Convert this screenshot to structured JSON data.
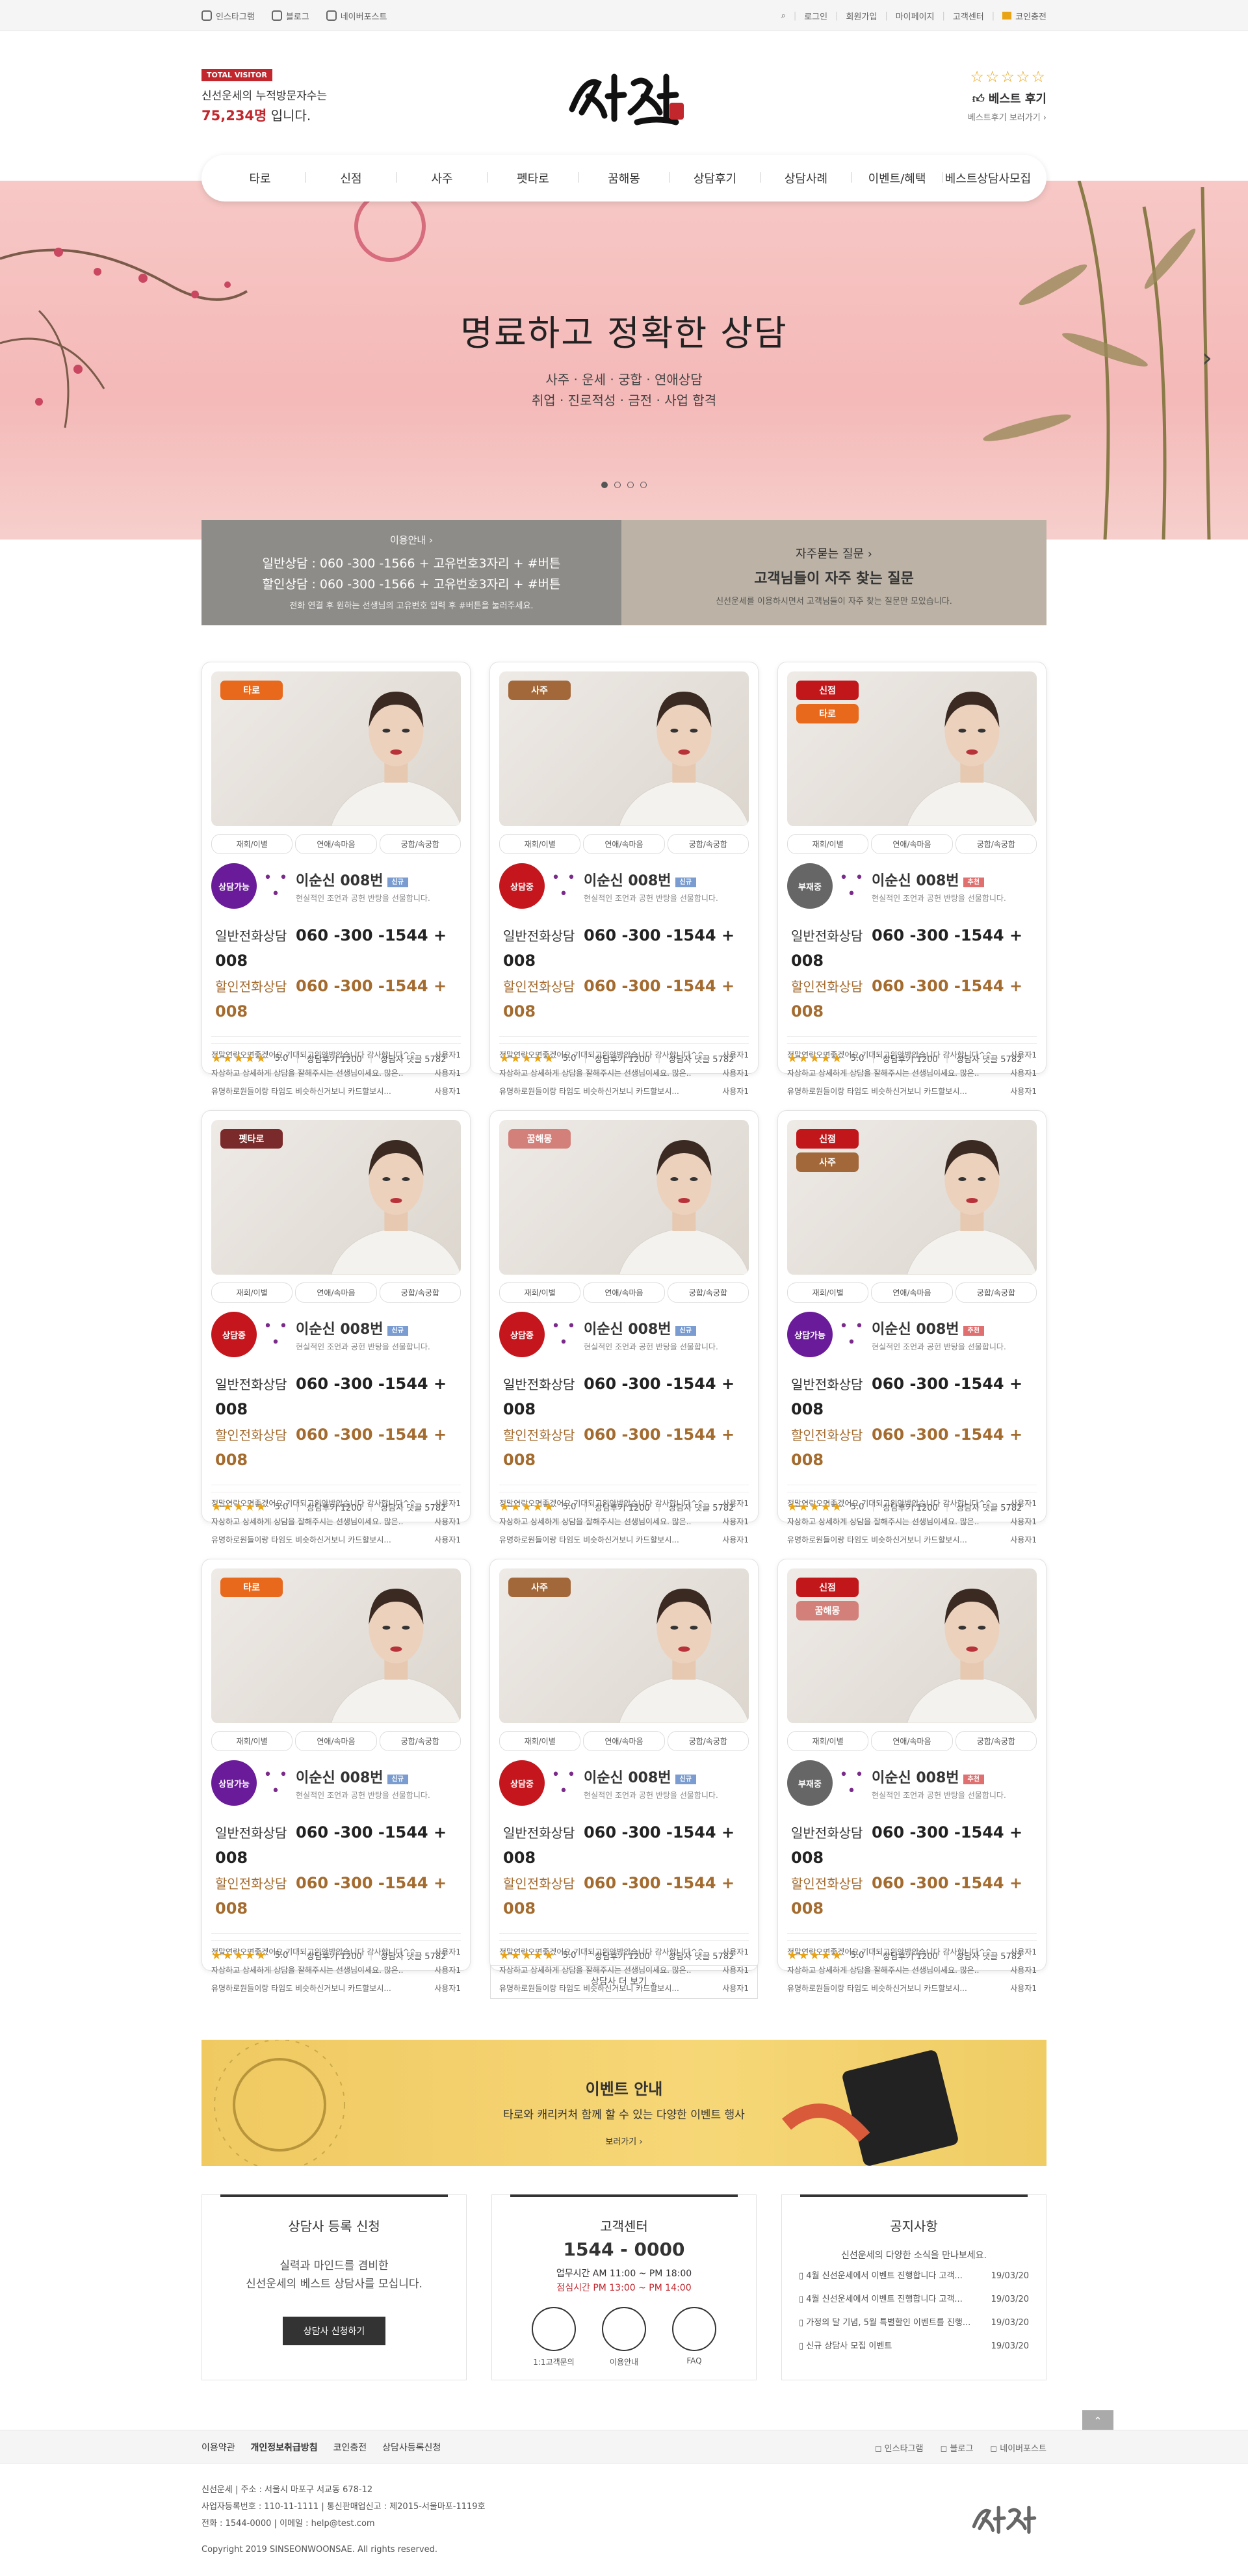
{
  "topbar": {
    "left": [
      "인스타그램",
      "블로그",
      "네이버포스트"
    ],
    "right": [
      "로그인",
      "회원가입",
      "마이페이지",
      "고객센터",
      "코인충전"
    ]
  },
  "visitor": {
    "badge": "TOTAL VISITOR",
    "line": "신선운세의 누적방문자수는",
    "num": "75,234명",
    "suffix": " 입니다."
  },
  "best": {
    "stars": "☆☆☆☆☆",
    "title": "베스트 후기",
    "sub": "베스트후기 보러가기 ›"
  },
  "nav": [
    "타로",
    "신점",
    "사주",
    "펫타로",
    "꿈해몽",
    "상담후기",
    "상담사례",
    "이벤트/혜택",
    "베스트상담사모집"
  ],
  "hero": {
    "title": "명료하고 정확한 상담",
    "sub1": "사주 · 운세 · 궁합 · 연애상담",
    "sub2": "취업 · 진로적성 · 금전 · 사업 합격"
  },
  "info": {
    "label": "이용안내 ›",
    "line1": "일반상담 : 060 -300 -1566 + 고유번호3자리 + #버튼",
    "line2": "할인상담 : 060 -300 -1566 + 고유번호3자리 + #버튼",
    "note": "전화 연결 후 원하는 선생님의 고유번호 입력 후 #버튼을 눌러주세요.",
    "faq": "자주묻는 질문 ›",
    "faq_title": "고객님들이 자주 찾는 질문",
    "faq_note": "신선운세를 이용하시면서 고객님들이 자주 찾는 질문만 모았습니다."
  },
  "card_common": {
    "tabs": [
      "재회/이별",
      "연애/속마음",
      "궁합/속궁합"
    ],
    "name": "이순신 008번",
    "desc": "현실적인 조언과 공헌 반탕을 선물합니다.",
    "p1k": "일반전화상담",
    "p1": "060 -300 -1544 + 008",
    "p2k": "할인전화상담",
    "p2": "060 -300 -1544 + 008",
    "reviews": [
      "정말연락오면좋겠어요 기대되고위안받았습니다 감사합니다^^.",
      "자상하고 상세하게 상담을 잘해주시는 선생님이세요. 많은..",
      "유명하로원들이랑 타임도 비슷하신거보니 카드할보시..."
    ],
    "user": "사용자1",
    "rating": "5.0",
    "rc": "상담후기 1200",
    "cc": "상담사 댓글 5782"
  },
  "cards": [
    {
      "tags": [
        "타로"
      ],
      "status": "상담가능",
      "nb": "신규"
    },
    {
      "tags": [
        "사주"
      ],
      "status": "상담중",
      "nb": "신규"
    },
    {
      "tags": [
        "신점",
        "타로"
      ],
      "status": "부재중",
      "nb": "추천"
    },
    {
      "tags": [
        "펫타로"
      ],
      "status": "상담중",
      "nb": "신규"
    },
    {
      "tags": [
        "꿈해몽"
      ],
      "status": "상담중",
      "nb": "신규"
    },
    {
      "tags": [
        "신점",
        "사주"
      ],
      "status": "상담가능",
      "nb": "추천"
    },
    {
      "tags": [
        "타로"
      ],
      "status": "상담가능",
      "nb": "신규"
    },
    {
      "tags": [
        "사주"
      ],
      "status": "상담중",
      "nb": "신규"
    },
    {
      "tags": [
        "신점",
        "꿈해몽"
      ],
      "status": "부재중",
      "nb": "추천"
    }
  ],
  "more": "상담사 더 보기 ⌄",
  "event": {
    "title": "이벤트 안내",
    "sub": "타로와 캐리커처 함께 할 수 있는 다양한 이벤트 행사",
    "more": "보러가기 ›"
  },
  "reg": {
    "title": "상담사 등록 신청",
    "s1": "실력과 마인드를 겸비한",
    "s2": "신선운세의 베스트 상담사를 모십니다.",
    "btn": "상담사 신청하기"
  },
  "cs": {
    "title": "고객센터",
    "phone": "1544 - 0000",
    "h1": "업무시간 AM 11:00 ~ PM 18:00",
    "h2": "점심시간 PM 13:00 ~ PM 14:00",
    "icons": [
      "1:1고객문의",
      "이용안내",
      "FAQ"
    ]
  },
  "notice": {
    "title": "공지사항",
    "sub": "신선운세의 다양한 소식을 만나보세요.",
    "items": [
      [
        "4월 신선운세에서 이벤트 진행합니다 고객...",
        "19/03/20"
      ],
      [
        "4월 신선운세에서 이벤트 진행합니다 고객...",
        "19/03/20"
      ],
      [
        "가정의 달 기념, 5월 특별할인 이벤트를 진행...",
        "19/03/20"
      ],
      [
        "신규 상담사 모집 이벤트",
        "19/03/20"
      ]
    ]
  },
  "footer": {
    "links": [
      "이용약관",
      "개인정보취급방침",
      "코인충전",
      "상담사등록신청"
    ],
    "social": [
      "인스타그램",
      "블로그",
      "네이버포스트"
    ],
    "info": [
      "신선운세  |  주소 : 서울시 마포구 서교동 678-12",
      "사업자등록번호 : 110-11-1111  |  통신판매업신고 : 제2015-서울마포-1119호",
      "전화 : 1544-0000  |  이메일 : help@test.com",
      "",
      "Copyright 2019 SINSEONWOONSAE. All rights reserved."
    ]
  },
  "colors": {
    "tag": {
      "타로": "#e8691c",
      "사주": "#a2683a",
      "신점": "#c1171b",
      "펫타로": "#7a2a2a",
      "꿈해몽": "#d4807a"
    },
    "status": {
      "상담가능": "#6a1b9a",
      "상담중": "#c4161c",
      "부재중": "#666666"
    },
    "nb": {
      "신규": "#7a9cd0",
      "추천": "#e07070"
    }
  }
}
